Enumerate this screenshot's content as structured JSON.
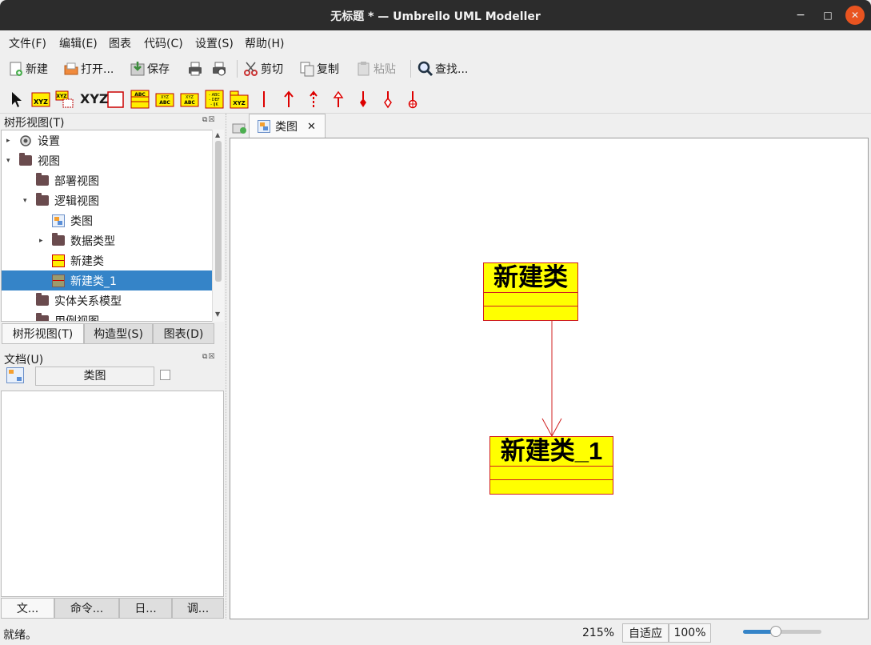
{
  "window": {
    "title": "无标题 * — Umbrello UML Modeller",
    "minimize": "−",
    "maximize": "□",
    "close": "✕"
  },
  "menubar": [
    "文件(F)",
    "编辑(E)",
    "图表",
    "代码(C)",
    "设置(S)",
    "帮助(H)"
  ],
  "toolbar": {
    "new_label": "新建",
    "open_label": "打开...",
    "save_label": "保存",
    "cut_label": "剪切",
    "copy_label": "复制",
    "paste_label": "粘贴",
    "find_label": "查找..."
  },
  "diagram_toolbar": {
    "tools": [
      "select-arrow",
      "class-xyz",
      "template-xyz",
      "text-xyz",
      "box",
      "class-abc",
      "interface-abc",
      "enum-abc",
      "datatype-list",
      "package-xyz",
      "association",
      "directed-association",
      "dependency",
      "generalization",
      "composition",
      "aggregation",
      "containment"
    ],
    "xyz_text": "XYZ",
    "small_abc": "ABC",
    "small_xyz": "XYZ",
    "list_lines": [
      "- ABC",
      "- DEF",
      "- IJK"
    ]
  },
  "tree_panel": {
    "title": "树形视图(T)",
    "items": [
      {
        "label": "设置",
        "icon": "gear-icon",
        "expander": "▸"
      },
      {
        "label": "视图",
        "icon": "folder-icon",
        "expander": "▾"
      },
      {
        "label": "部署视图",
        "icon": "folder-icon"
      },
      {
        "label": "逻辑视图",
        "icon": "folder-icon",
        "expander": "▾"
      },
      {
        "label": "类图",
        "icon": "class-diagram-icon"
      },
      {
        "label": "数据类型",
        "icon": "folder-icon",
        "expander": "▸"
      },
      {
        "label": "新建类",
        "icon": "class-icon"
      },
      {
        "label": "新建类_1",
        "icon": "class-icon",
        "selected": true
      },
      {
        "label": "实体关系模型",
        "icon": "folder-icon"
      },
      {
        "label": "用例视图",
        "icon": "folder-icon"
      }
    ],
    "tabs": [
      "树形视图(T)",
      "构造型(S)",
      "图表(D)"
    ],
    "active_tab": 0
  },
  "doc_panel": {
    "title": "文档(U)",
    "field_value": "类图",
    "tabs": [
      "文...",
      "命令...",
      "日...",
      "调..."
    ],
    "active_tab": 0
  },
  "diagram_tab": {
    "label": "类图",
    "close": "✕"
  },
  "canvas": {
    "classes": [
      {
        "name": "新建类"
      },
      {
        "name": "新建类_1"
      }
    ],
    "association": "新建类 → 新建类_1 (directed)"
  },
  "statusbar": {
    "message": "就绪。",
    "zoom": "215%",
    "fit_label": "自适应",
    "reset_label": "100%",
    "zoom_slider_fraction": 0.42
  },
  "colors": {
    "selection": "#3584c8",
    "uml_fill": "#ffff00",
    "uml_border": "#d02020",
    "titlebar": "#2c2c2c",
    "close_button": "#e95420"
  }
}
